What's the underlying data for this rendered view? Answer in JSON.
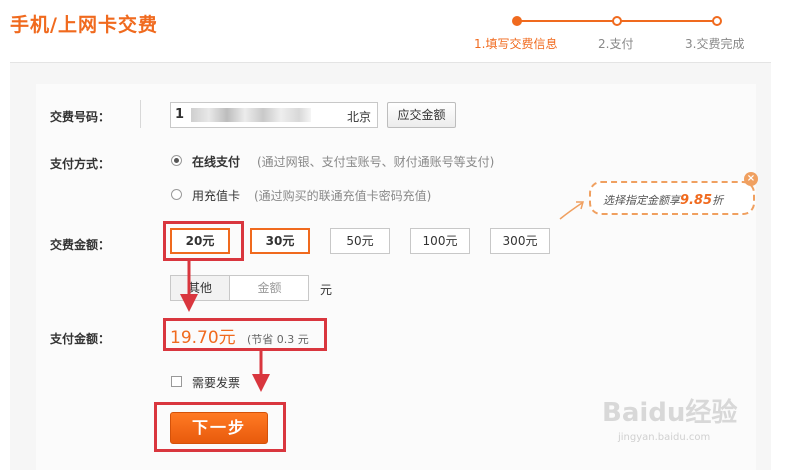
{
  "header": {
    "title": "手机/上网卡交费"
  },
  "steps": [
    {
      "label": "1.填写交费信息",
      "active": true
    },
    {
      "label": "2.支付",
      "active": false
    },
    {
      "label": "3.交费完成",
      "active": false
    }
  ],
  "form": {
    "phone": {
      "label": "交费号码：",
      "prefix": "1",
      "city": "北京",
      "button": "应交金额"
    },
    "payment": {
      "label": "支付方式：",
      "options": [
        {
          "label": "在线支付",
          "note": "(通过网银、支付宝账号、财付通账号等支付)",
          "selected": true
        },
        {
          "label": "用充值卡",
          "note": "(通过购买的联通充值卡密码充值)",
          "selected": false
        }
      ]
    },
    "amount": {
      "label": "交费金额：",
      "options": [
        "20元",
        "30元",
        "50元",
        "100元",
        "300元"
      ],
      "selected": "30元",
      "other_tab": "其他",
      "other_placeholder": "金额",
      "unit": "元"
    },
    "pay": {
      "label": "支付金额：",
      "value": "19.70元",
      "savings": "(节省 0.3 元"
    },
    "invoice": {
      "label": "需要发票",
      "checked": false
    },
    "next_button": "下一步"
  },
  "promo": {
    "text_prefix": "选择指定金额享",
    "discount": "9.85",
    "text_suffix": "折",
    "close": "×"
  },
  "watermark": {
    "brand": "Baidu经验",
    "url": "jingyan.baidu.com"
  },
  "colors": {
    "accent": "#f06a1e",
    "annotation": "#d9363e"
  }
}
